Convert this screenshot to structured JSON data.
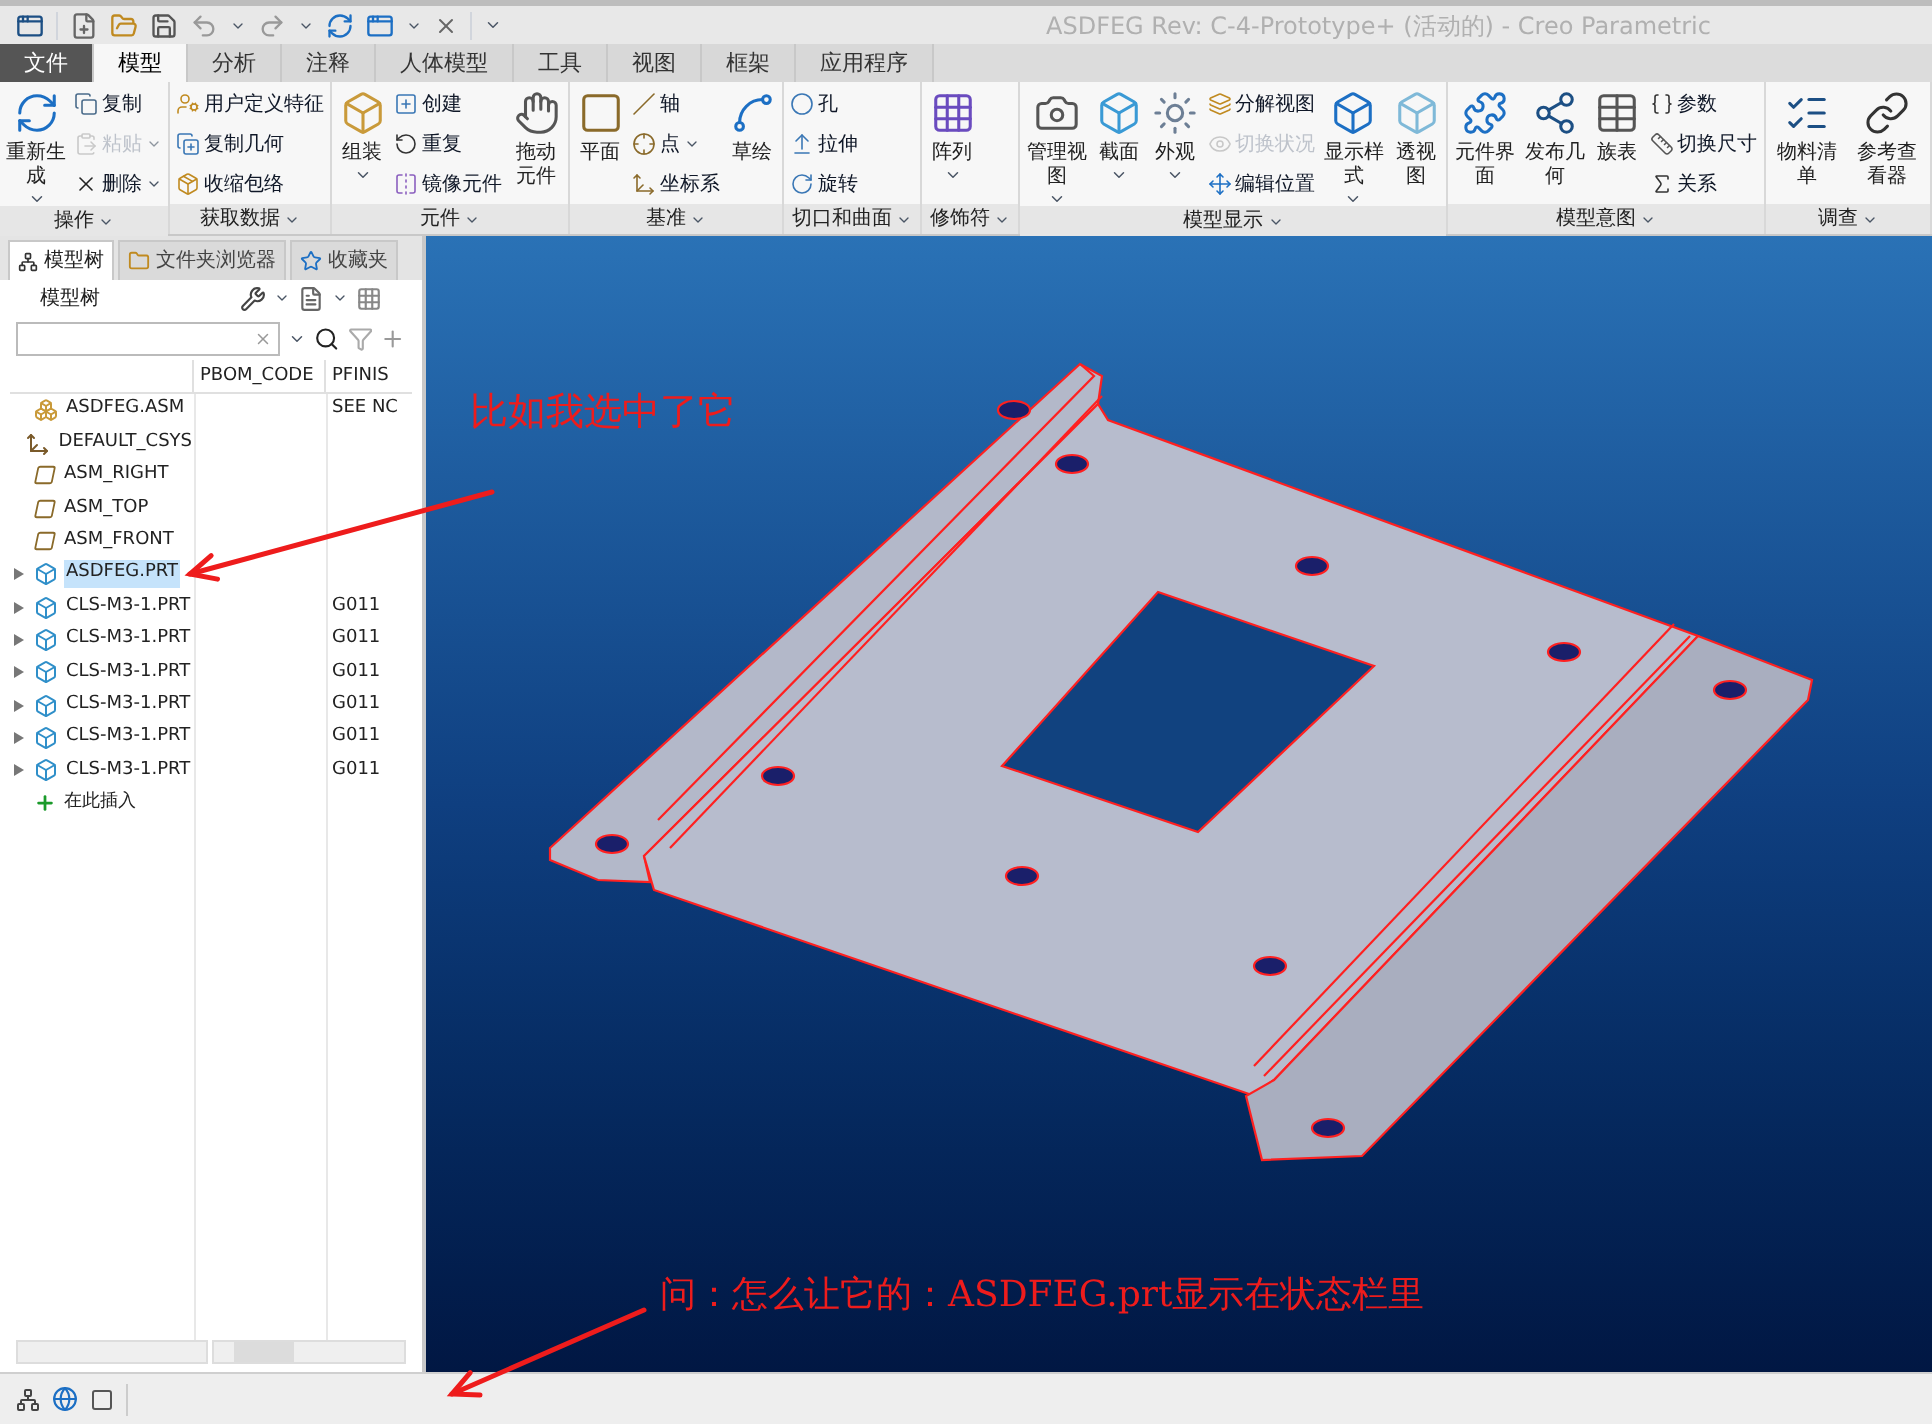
{
  "title_bar": {
    "title": "ASDFEG Rev: C-4-Prototype+ (活动的) - Creo Parametric"
  },
  "ribbon": {
    "tabs": [
      {
        "label": "文件",
        "kind": "file"
      },
      {
        "label": "模型",
        "kind": "tab",
        "selected": true
      },
      {
        "label": "分析",
        "kind": "tab",
        "selected": false
      },
      {
        "label": "注释",
        "kind": "tab",
        "selected": false
      },
      {
        "label": "人体模型",
        "kind": "tab",
        "selected": false
      },
      {
        "label": "工具",
        "kind": "tab",
        "selected": false
      },
      {
        "label": "视图",
        "kind": "tab",
        "selected": false
      },
      {
        "label": "框架",
        "kind": "tab",
        "selected": false
      },
      {
        "label": "应用程序",
        "kind": "tab",
        "selected": false
      }
    ],
    "groups": [
      {
        "label": "操作",
        "columns": [
          {
            "kind": "large",
            "label": "重新生成",
            "dropdown": true
          },
          {
            "kind": "stack",
            "items": [
              {
                "label": "复制",
                "disabled": false,
                "dropdown": false
              },
              {
                "label": "粘贴",
                "disabled": true,
                "dropdown": true
              },
              {
                "label": "删除",
                "disabled": false,
                "dropdown": true
              }
            ]
          }
        ]
      },
      {
        "label": "获取数据",
        "columns": [
          {
            "kind": "stack",
            "items": [
              {
                "label": "用户定义特征",
                "disabled": false,
                "dropdown": false
              },
              {
                "label": "复制几何",
                "disabled": false,
                "dropdown": false
              },
              {
                "label": "收缩包络",
                "disabled": false,
                "dropdown": false
              }
            ]
          }
        ]
      },
      {
        "label": "元件",
        "columns": [
          {
            "kind": "large",
            "label": "组装",
            "dropdown": true
          },
          {
            "kind": "stack",
            "items": [
              {
                "label": "创建",
                "disabled": false,
                "dropdown": false
              },
              {
                "label": "重复",
                "disabled": false,
                "dropdown": false
              },
              {
                "label": "镜像元件",
                "disabled": false,
                "dropdown": false
              }
            ]
          },
          {
            "kind": "large",
            "label": "拖动元件",
            "dropdown": false
          }
        ]
      },
      {
        "label": "基准",
        "columns": [
          {
            "kind": "large",
            "label": "平面",
            "dropdown": false
          },
          {
            "kind": "stack",
            "items": [
              {
                "label": "轴",
                "disabled": false,
                "dropdown": false
              },
              {
                "label": "点",
                "disabled": false,
                "dropdown": true
              },
              {
                "label": "坐标系",
                "disabled": false,
                "dropdown": false
              }
            ]
          },
          {
            "kind": "large",
            "label": "草绘",
            "dropdown": false
          }
        ]
      },
      {
        "label": "切口和曲面",
        "columns": [
          {
            "kind": "stack",
            "items": [
              {
                "label": "孔",
                "disabled": false,
                "dropdown": false
              },
              {
                "label": "拉伸",
                "disabled": false,
                "dropdown": false
              },
              {
                "label": "旋转",
                "disabled": false,
                "dropdown": false
              }
            ]
          }
        ]
      },
      {
        "label": "修饰符",
        "columns": [
          {
            "kind": "large",
            "label": "阵列",
            "dropdown": true
          }
        ]
      },
      {
        "label": "模型显示",
        "columns": [
          {
            "kind": "large",
            "label": "管理视图",
            "dropdown": true
          },
          {
            "kind": "large",
            "label": "截面",
            "dropdown": true
          },
          {
            "kind": "large",
            "label": "外观",
            "dropdown": true
          },
          {
            "kind": "stack",
            "items": [
              {
                "label": "分解视图",
                "disabled": false,
                "dropdown": false
              },
              {
                "label": "切换状况",
                "disabled": true,
                "dropdown": false
              },
              {
                "label": "编辑位置",
                "disabled": false,
                "dropdown": false
              }
            ]
          },
          {
            "kind": "large",
            "label": "显示样式",
            "dropdown": true
          },
          {
            "kind": "large",
            "label": "透视图",
            "dropdown": false
          }
        ]
      },
      {
        "label": "模型意图",
        "columns": [
          {
            "kind": "large",
            "label": "元件界面",
            "dropdown": false
          },
          {
            "kind": "large",
            "label": "发布几何",
            "dropdown": false
          },
          {
            "kind": "large",
            "label": "族表",
            "dropdown": false
          },
          {
            "kind": "stack",
            "items": [
              {
                "label": "参数",
                "disabled": false,
                "dropdown": false
              },
              {
                "label": "切换尺寸",
                "disabled": false,
                "dropdown": false
              },
              {
                "label": "关系",
                "disabled": false,
                "dropdown": false
              }
            ]
          }
        ]
      },
      {
        "label": "调查",
        "columns": [
          {
            "kind": "large",
            "label": "物料清单",
            "dropdown": false
          },
          {
            "kind": "large",
            "label": "参考查看器",
            "dropdown": false
          }
        ]
      }
    ]
  },
  "model_tree": {
    "tabs": [
      {
        "label": "模型树",
        "selected": true
      },
      {
        "label": "文件夹浏览器",
        "selected": false
      },
      {
        "label": "收藏夹",
        "selected": false
      }
    ],
    "title": "模型树",
    "columns": [
      {
        "label": "PBOM_CODE"
      },
      {
        "label": "PFINIS"
      }
    ],
    "rows": [
      {
        "kind": "assembly",
        "name": "ASDFEG.ASM",
        "expandable": false,
        "selected": false,
        "pfinis": "SEE NC"
      },
      {
        "kind": "csys",
        "name": "DEFAULT_CSYS",
        "expandable": false,
        "selected": false
      },
      {
        "kind": "plane",
        "name": "ASM_RIGHT",
        "expandable": false,
        "selected": false
      },
      {
        "kind": "plane",
        "name": "ASM_TOP",
        "expandable": false,
        "selected": false
      },
      {
        "kind": "plane",
        "name": "ASM_FRONT",
        "expandable": false,
        "selected": false
      },
      {
        "kind": "part",
        "name": "ASDFEG.PRT",
        "expandable": true,
        "selected": true
      },
      {
        "kind": "part",
        "name": "CLS-M3-1.PRT",
        "expandable": true,
        "selected": false,
        "pfinis": "G011"
      },
      {
        "kind": "part",
        "name": "CLS-M3-1.PRT",
        "expandable": true,
        "selected": false,
        "pfinis": "G011"
      },
      {
        "kind": "part",
        "name": "CLS-M3-1.PRT",
        "expandable": true,
        "selected": false,
        "pfinis": "G011"
      },
      {
        "kind": "part",
        "name": "CLS-M3-1.PRT",
        "expandable": true,
        "selected": false,
        "pfinis": "G011"
      },
      {
        "kind": "part",
        "name": "CLS-M3-1.PRT",
        "expandable": true,
        "selected": false,
        "pfinis": "G011"
      },
      {
        "kind": "part",
        "name": "CLS-M3-1.PRT",
        "expandable": true,
        "selected": false,
        "pfinis": "G011"
      },
      {
        "kind": "insert",
        "name": "在此插入",
        "expandable": false,
        "selected": false
      }
    ]
  },
  "annotations": [
    {
      "text": "比如我选中了它"
    },
    {
      "text": "问：怎么让它的：ASDFEG.prt显示在状态栏里"
    }
  ]
}
